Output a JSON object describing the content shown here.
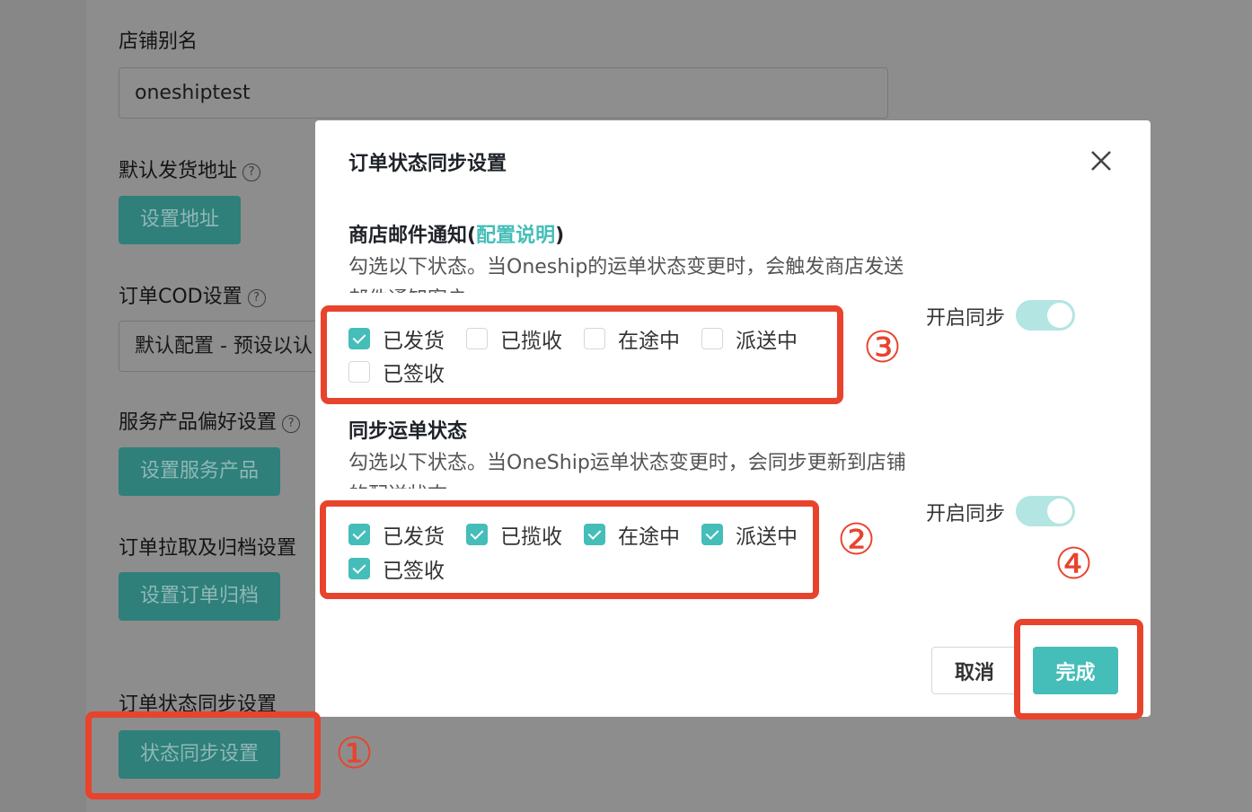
{
  "background": {
    "store_alias_label": "店铺别名",
    "store_alias_value": "oneshiptest",
    "default_address_label": "默认发货地址",
    "default_address_button": "设置地址",
    "cod_label": "订单COD设置",
    "cod_value": "默认配置 - 预设以认",
    "service_pref_label": "服务产品偏好设置",
    "service_pref_button": "设置服务产品",
    "order_pull_label": "订单拉取及归档设置",
    "order_pull_button": "设置订单归档",
    "status_sync_label": "订单状态同步设置",
    "status_sync_button": "状态同步设置",
    "help_glyph": "?"
  },
  "modal": {
    "title": "订单状态同步设置",
    "close_glyph": "×",
    "email_section": {
      "title_prefix": "商店邮件通知(",
      "title_link": "配置说明",
      "title_suffix": ")",
      "desc": "勾选以下状态。当Oneship的运单状态变更时，会触发商店发送邮件通知客户",
      "sync_label": "开启同步",
      "sync_enabled": true,
      "options": [
        {
          "label": "已发货",
          "checked": true
        },
        {
          "label": "已揽收",
          "checked": false
        },
        {
          "label": "在途中",
          "checked": false
        },
        {
          "label": "派送中",
          "checked": false
        },
        {
          "label": "已签收",
          "checked": false
        }
      ]
    },
    "sync_section": {
      "title": "同步运单状态",
      "desc": "勾选以下状态。当OneShip运单状态变更时，会同步更新到店铺的配送状态",
      "sync_label": "开启同步",
      "sync_enabled": true,
      "options": [
        {
          "label": "已发货",
          "checked": true
        },
        {
          "label": "已揽收",
          "checked": true
        },
        {
          "label": "在途中",
          "checked": true
        },
        {
          "label": "派送中",
          "checked": true
        },
        {
          "label": "已签收",
          "checked": true
        }
      ]
    },
    "cancel_button": "取消",
    "done_button": "完成"
  },
  "annotations": [
    "①",
    "②",
    "③",
    "④"
  ],
  "colors": {
    "accent": "#45bdb8",
    "annotation": "#e8432d"
  }
}
